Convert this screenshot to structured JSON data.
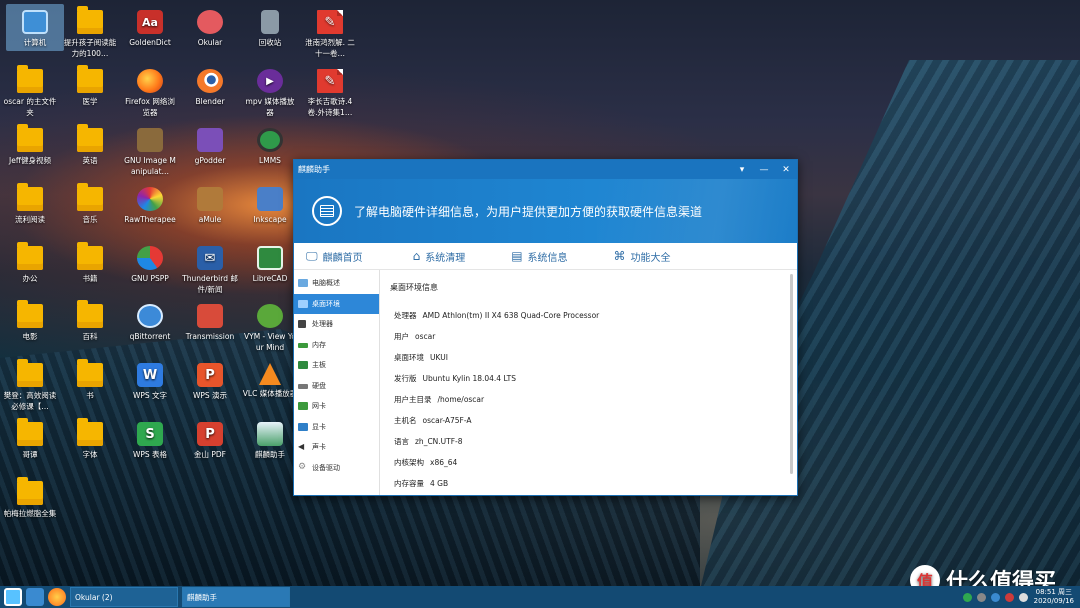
{
  "desktop_icons": [
    {
      "label": "计算机"
    },
    {
      "label": "提升孩子阅读能力的100…"
    },
    {
      "label": "GoldenDict"
    },
    {
      "label": "Okular"
    },
    {
      "label": "回收站"
    },
    {
      "label": "淮南鸿烈解. 二十一卷…"
    },
    {
      "label": "oscar 的主文件夹"
    },
    {
      "label": "医学"
    },
    {
      "label": "Firefox 网络浏览器"
    },
    {
      "label": "Blender"
    },
    {
      "label": "mpv 媒体播放器"
    },
    {
      "label": "李长吉歌诗.4 卷.外诗集1…"
    },
    {
      "label": "Jeff健身视频"
    },
    {
      "label": "英语"
    },
    {
      "label": "GNU Image Manipulat…"
    },
    {
      "label": "gPodder"
    },
    {
      "label": "LMMS"
    },
    {
      "label": "流利阅读"
    },
    {
      "label": "音乐"
    },
    {
      "label": "RawTherapee"
    },
    {
      "label": "aMule"
    },
    {
      "label": "Inkscape"
    },
    {
      "label": "办公"
    },
    {
      "label": "书籍"
    },
    {
      "label": "GNU PSPP"
    },
    {
      "label": "Thunderbird 邮件/新闻"
    },
    {
      "label": "LibreCAD"
    },
    {
      "label": "电影"
    },
    {
      "label": "百科"
    },
    {
      "label": "qBittorrent"
    },
    {
      "label": "Transmission"
    },
    {
      "label": "VYM - View Your Mind"
    },
    {
      "label": "樊登：高效阅读必修课【…"
    },
    {
      "label": "书"
    },
    {
      "label": "WPS 文字"
    },
    {
      "label": "WPS 演示"
    },
    {
      "label": "VLC 媒体播放器"
    },
    {
      "label": "哥谭"
    },
    {
      "label": "字体"
    },
    {
      "label": "WPS 表格"
    },
    {
      "label": "金山 PDF"
    },
    {
      "label": "麒麟助手"
    },
    {
      "label": "帕梅拉燃脂全集"
    }
  ],
  "window": {
    "title": "麒麟助手",
    "banner_text": "了解电脑硬件详细信息，为用户提供更加方便的获取硬件信息渠道",
    "tabs": [
      {
        "label": "麒麟首页"
      },
      {
        "label": "系统清理"
      },
      {
        "label": "系统信息"
      },
      {
        "label": "功能大全"
      }
    ],
    "sidebar": [
      {
        "label": "电脑概述"
      },
      {
        "label": "桌面环境"
      },
      {
        "label": "处理器"
      },
      {
        "label": "内存"
      },
      {
        "label": "主板"
      },
      {
        "label": "硬盘"
      },
      {
        "label": "网卡"
      },
      {
        "label": "显卡"
      },
      {
        "label": "声卡"
      },
      {
        "label": "设备驱动"
      }
    ],
    "content_title": "桌面环境信息",
    "info": [
      {
        "key": "处理器",
        "value": "AMD Athlon(tm) II X4 638 Quad-Core Processor"
      },
      {
        "key": "用户",
        "value": "oscar"
      },
      {
        "key": "桌面环境",
        "value": "UKUI"
      },
      {
        "key": "发行版",
        "value": "Ubuntu Kylin 18.04.4 LTS"
      },
      {
        "key": "用户主目录",
        "value": "/home/oscar"
      },
      {
        "key": "主机名",
        "value": "oscar-A75F-A"
      },
      {
        "key": "语言",
        "value": "zh_CN.UTF-8"
      },
      {
        "key": "内核架构",
        "value": "x86_64"
      },
      {
        "key": "内存容量",
        "value": "4 GB"
      }
    ]
  },
  "taskbar": {
    "items": [
      {
        "label": "Okular (2)"
      },
      {
        "label": "麒麟助手"
      }
    ],
    "time": "08:51 周三",
    "date": "2020/09/16"
  },
  "watermark": {
    "badge": "值",
    "text": "什么值得买"
  }
}
